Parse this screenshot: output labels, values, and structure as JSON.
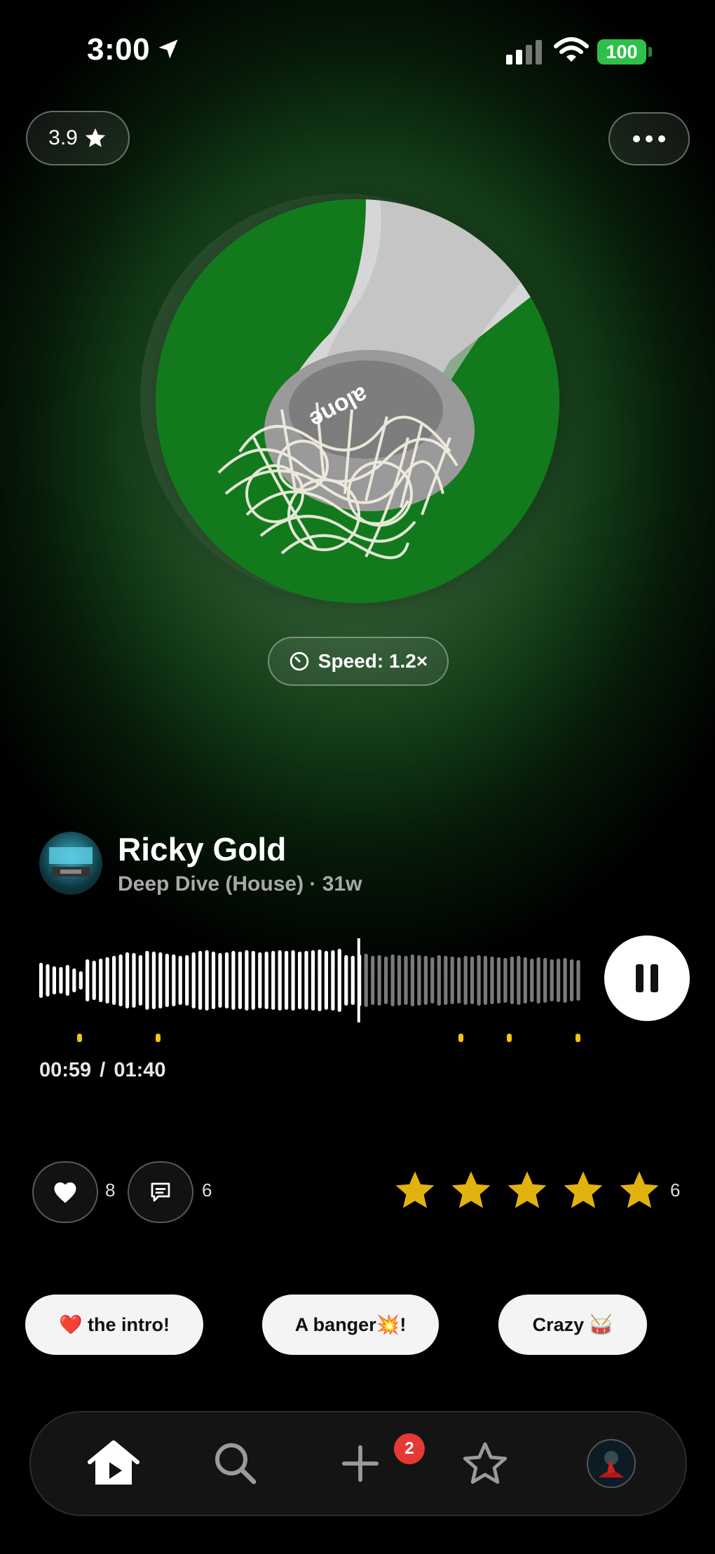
{
  "status": {
    "time": "3:00",
    "battery": "100"
  },
  "header": {
    "rating": "3.9"
  },
  "artwork": {
    "text": "alone"
  },
  "speed": {
    "label": "Speed: 1.2×"
  },
  "track": {
    "artist": "Ricky Gold",
    "subtitle": "Deep Dive (House) · 31w",
    "elapsed": "00:59",
    "separator": "/",
    "duration": "01:40",
    "progress": 0.59
  },
  "actions": {
    "likes": "8",
    "comments": "6",
    "rating_value": 5,
    "rating_count": "6"
  },
  "reactions": [
    "❤️ the intro!",
    "A banger💥!",
    "Crazy 🥁"
  ],
  "nav": {
    "items": [
      "home-icon",
      "search-icon",
      "add-icon",
      "star-icon",
      "profile-avatar"
    ],
    "badge": "2"
  },
  "colors": {
    "accent_green": "#2ec04a",
    "art_green": "#127a1c",
    "star_gold": "#e2b20e",
    "marker_yellow": "#f2c40c",
    "badge_red": "#e53935"
  }
}
